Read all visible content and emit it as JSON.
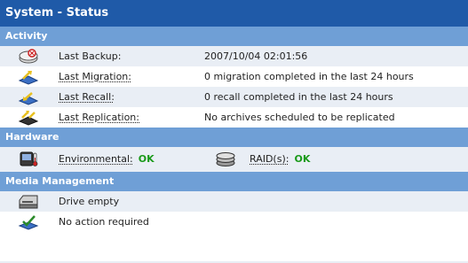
{
  "panel": {
    "title": "System - Status"
  },
  "activity": {
    "header": "Activity",
    "rows": [
      {
        "label": "Last Backup:",
        "value": "2007/10/04 02:01:56",
        "icon": "backup-icon"
      },
      {
        "label": "Last Migration:",
        "value": "0 migration completed in the last 24 hours",
        "icon": "migration-icon"
      },
      {
        "label": "Last Recall:",
        "value": "0 recall completed in the last 24 hours",
        "icon": "recall-icon"
      },
      {
        "label": "Last Replication:",
        "value": "No archives scheduled to be replicated",
        "icon": "replication-icon"
      }
    ]
  },
  "hardware": {
    "header": "Hardware",
    "environmental": {
      "label": "Environmental:",
      "status": "OK",
      "icon": "thermometer-icon"
    },
    "raid": {
      "label": "RAID(s):",
      "status": "OK",
      "icon": "raid-disks-icon"
    },
    "status_color": "#1a9a1a"
  },
  "media": {
    "header": "Media Management",
    "rows": [
      {
        "label": "Drive empty",
        "icon": "drive-icon"
      },
      {
        "label": "No action required",
        "icon": "checkmark-icon"
      }
    ]
  },
  "colors": {
    "title_bg": "#1f5aa8",
    "section_bg": "#6f9fd6",
    "row_shade": "#e9eef5"
  }
}
